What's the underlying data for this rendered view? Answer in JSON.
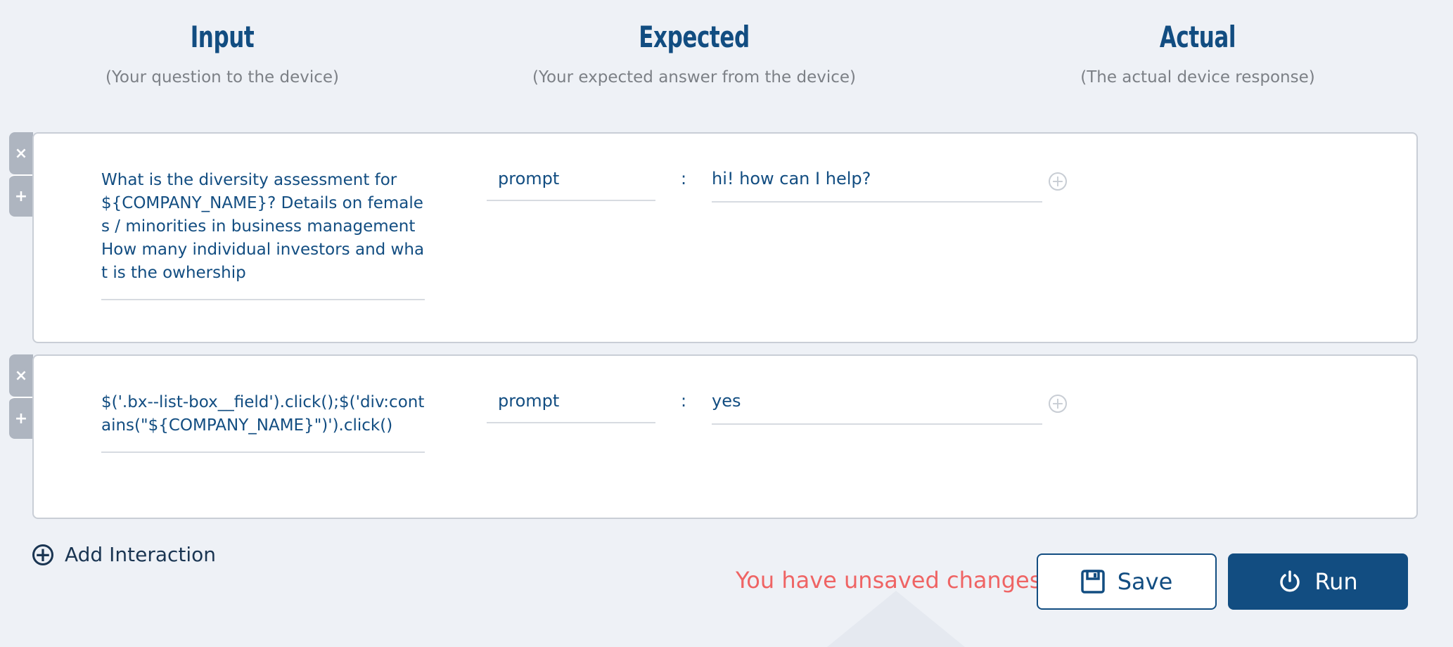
{
  "columns": {
    "input": {
      "title": "Input",
      "subtitle": "(Your question to the device)"
    },
    "expected": {
      "title": "Expected",
      "subtitle": "(Your expected answer from the device)"
    },
    "actual": {
      "title": "Actual",
      "subtitle": "(The actual device response)"
    }
  },
  "interactions": [
    {
      "input": "What is the diversity assessment for ${COMPANY_NAME}? Details on females / minorities in business management How many individual investors and what is the owhership",
      "type": "prompt",
      "separator": ":",
      "expected": "hi! how can I help?",
      "remove_glyph": "×",
      "add_glyph": "+",
      "add_expected_glyph": "+"
    },
    {
      "input": "$('.bx--list-box__field').click();$('div:contains(\"${COMPANY_NAME}\")').click()",
      "type": "prompt",
      "separator": ":",
      "expected": "yes",
      "remove_glyph": "×",
      "add_glyph": "+",
      "add_expected_glyph": "+"
    }
  ],
  "footer": {
    "add_interaction_label": "Add Interaction",
    "add_interaction_glyph": "+",
    "unsaved_message": "You have unsaved changes",
    "save_label": "Save",
    "run_label": "Run"
  },
  "icons": {
    "save": "floppy-disk-icon",
    "run": "power-icon",
    "add": "plus-circle-icon",
    "remove": "close-icon"
  },
  "colors": {
    "primary": "#124d81",
    "warning": "#ef6464",
    "background": "#eef1f6"
  }
}
